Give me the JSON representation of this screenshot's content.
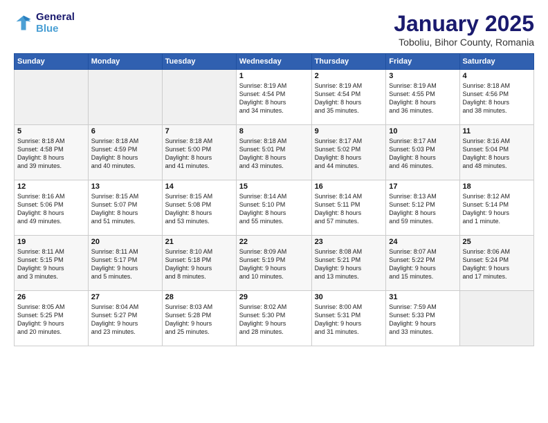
{
  "header": {
    "logo_line1": "General",
    "logo_line2": "Blue",
    "title": "January 2025",
    "subtitle": "Toboliu, Bihor County, Romania"
  },
  "days_of_week": [
    "Sunday",
    "Monday",
    "Tuesday",
    "Wednesday",
    "Thursday",
    "Friday",
    "Saturday"
  ],
  "weeks": [
    [
      {
        "num": "",
        "info": ""
      },
      {
        "num": "",
        "info": ""
      },
      {
        "num": "",
        "info": ""
      },
      {
        "num": "1",
        "info": "Sunrise: 8:19 AM\nSunset: 4:54 PM\nDaylight: 8 hours\nand 34 minutes."
      },
      {
        "num": "2",
        "info": "Sunrise: 8:19 AM\nSunset: 4:54 PM\nDaylight: 8 hours\nand 35 minutes."
      },
      {
        "num": "3",
        "info": "Sunrise: 8:19 AM\nSunset: 4:55 PM\nDaylight: 8 hours\nand 36 minutes."
      },
      {
        "num": "4",
        "info": "Sunrise: 8:18 AM\nSunset: 4:56 PM\nDaylight: 8 hours\nand 38 minutes."
      }
    ],
    [
      {
        "num": "5",
        "info": "Sunrise: 8:18 AM\nSunset: 4:58 PM\nDaylight: 8 hours\nand 39 minutes."
      },
      {
        "num": "6",
        "info": "Sunrise: 8:18 AM\nSunset: 4:59 PM\nDaylight: 8 hours\nand 40 minutes."
      },
      {
        "num": "7",
        "info": "Sunrise: 8:18 AM\nSunset: 5:00 PM\nDaylight: 8 hours\nand 41 minutes."
      },
      {
        "num": "8",
        "info": "Sunrise: 8:18 AM\nSunset: 5:01 PM\nDaylight: 8 hours\nand 43 minutes."
      },
      {
        "num": "9",
        "info": "Sunrise: 8:17 AM\nSunset: 5:02 PM\nDaylight: 8 hours\nand 44 minutes."
      },
      {
        "num": "10",
        "info": "Sunrise: 8:17 AM\nSunset: 5:03 PM\nDaylight: 8 hours\nand 46 minutes."
      },
      {
        "num": "11",
        "info": "Sunrise: 8:16 AM\nSunset: 5:04 PM\nDaylight: 8 hours\nand 48 minutes."
      }
    ],
    [
      {
        "num": "12",
        "info": "Sunrise: 8:16 AM\nSunset: 5:06 PM\nDaylight: 8 hours\nand 49 minutes."
      },
      {
        "num": "13",
        "info": "Sunrise: 8:15 AM\nSunset: 5:07 PM\nDaylight: 8 hours\nand 51 minutes."
      },
      {
        "num": "14",
        "info": "Sunrise: 8:15 AM\nSunset: 5:08 PM\nDaylight: 8 hours\nand 53 minutes."
      },
      {
        "num": "15",
        "info": "Sunrise: 8:14 AM\nSunset: 5:10 PM\nDaylight: 8 hours\nand 55 minutes."
      },
      {
        "num": "16",
        "info": "Sunrise: 8:14 AM\nSunset: 5:11 PM\nDaylight: 8 hours\nand 57 minutes."
      },
      {
        "num": "17",
        "info": "Sunrise: 8:13 AM\nSunset: 5:12 PM\nDaylight: 8 hours\nand 59 minutes."
      },
      {
        "num": "18",
        "info": "Sunrise: 8:12 AM\nSunset: 5:14 PM\nDaylight: 9 hours\nand 1 minute."
      }
    ],
    [
      {
        "num": "19",
        "info": "Sunrise: 8:11 AM\nSunset: 5:15 PM\nDaylight: 9 hours\nand 3 minutes."
      },
      {
        "num": "20",
        "info": "Sunrise: 8:11 AM\nSunset: 5:17 PM\nDaylight: 9 hours\nand 5 minutes."
      },
      {
        "num": "21",
        "info": "Sunrise: 8:10 AM\nSunset: 5:18 PM\nDaylight: 9 hours\nand 8 minutes."
      },
      {
        "num": "22",
        "info": "Sunrise: 8:09 AM\nSunset: 5:19 PM\nDaylight: 9 hours\nand 10 minutes."
      },
      {
        "num": "23",
        "info": "Sunrise: 8:08 AM\nSunset: 5:21 PM\nDaylight: 9 hours\nand 13 minutes."
      },
      {
        "num": "24",
        "info": "Sunrise: 8:07 AM\nSunset: 5:22 PM\nDaylight: 9 hours\nand 15 minutes."
      },
      {
        "num": "25",
        "info": "Sunrise: 8:06 AM\nSunset: 5:24 PM\nDaylight: 9 hours\nand 17 minutes."
      }
    ],
    [
      {
        "num": "26",
        "info": "Sunrise: 8:05 AM\nSunset: 5:25 PM\nDaylight: 9 hours\nand 20 minutes."
      },
      {
        "num": "27",
        "info": "Sunrise: 8:04 AM\nSunset: 5:27 PM\nDaylight: 9 hours\nand 23 minutes."
      },
      {
        "num": "28",
        "info": "Sunrise: 8:03 AM\nSunset: 5:28 PM\nDaylight: 9 hours\nand 25 minutes."
      },
      {
        "num": "29",
        "info": "Sunrise: 8:02 AM\nSunset: 5:30 PM\nDaylight: 9 hours\nand 28 minutes."
      },
      {
        "num": "30",
        "info": "Sunrise: 8:00 AM\nSunset: 5:31 PM\nDaylight: 9 hours\nand 31 minutes."
      },
      {
        "num": "31",
        "info": "Sunrise: 7:59 AM\nSunset: 5:33 PM\nDaylight: 9 hours\nand 33 minutes."
      },
      {
        "num": "",
        "info": ""
      }
    ]
  ]
}
